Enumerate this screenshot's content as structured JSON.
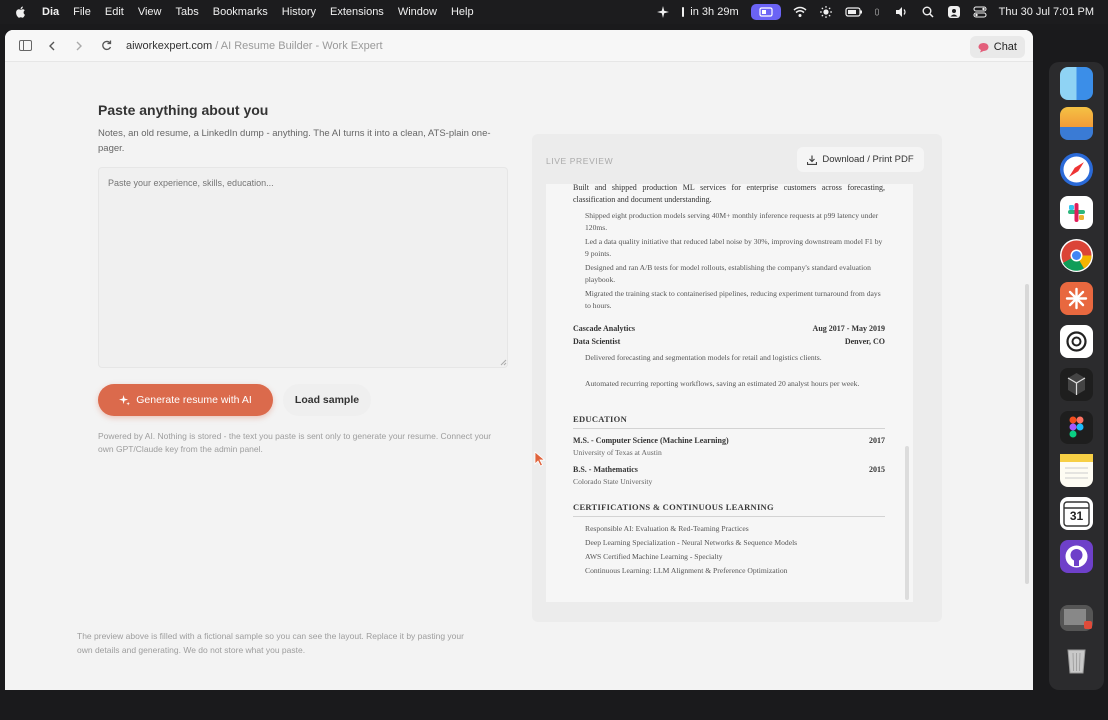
{
  "menubar": {
    "app_name": "Dia",
    "menus": [
      "File",
      "Edit",
      "View",
      "Tabs",
      "Bookmarks",
      "History",
      "Extensions",
      "Window",
      "Help"
    ],
    "timer": "in 3h 29m",
    "datetime": "Thu 30 Jul  7:01 PM"
  },
  "browser": {
    "url_domain": "aiworkexpert.com",
    "url_rest": " / AI Resume Builder - Work Expert",
    "chat_label": "Chat"
  },
  "left": {
    "title": "Paste anything about you",
    "description": "Notes, an old resume, a LinkedIn dump - anything. The AI turns it into a clean, ATS-plain one-pager.",
    "textarea_placeholder": "Paste your experience, skills, education...",
    "generate_label": "Generate resume with AI",
    "sample_label": "Load sample",
    "powered": "Powered by AI. Nothing is stored - the text you paste is sent only to generate your resume. Connect your own GPT/Claude key from the admin panel.",
    "footnote": "The preview above is filled with a fictional sample so you can see the layout. Replace it by pasting your own details and generating. We do not store what you paste."
  },
  "preview": {
    "label": "LIVE PREVIEW",
    "download_label": "Download / Print PDF",
    "intro": "Built and shipped production ML services for enterprise customers across forecasting, classification and document understanding.",
    "job1_bullets": [
      "Shipped eight production models serving 40M+ monthly inference requests at p99 latency under 120ms.",
      "Led a data quality initiative that reduced label noise by 30%, improving downstream model F1 by 9 points.",
      "Designed and ran A/B tests for model rollouts, establishing the company's standard evaluation playbook.",
      "Migrated the training stack to containerised pipelines, reducing experiment turnaround from days to hours."
    ],
    "job2": {
      "company": "Cascade Analytics",
      "dates": "Aug 2017 - May 2019",
      "role": "Data Scientist",
      "location": "Denver, CO",
      "bullets": [
        "Delivered forecasting and segmentation models for retail and logistics clients.",
        "Automated recurring reporting workflows, saving an estimated 20 analyst hours per week."
      ]
    },
    "education_heading": "EDUCATION",
    "education": [
      {
        "degree": "M.S. - Computer Science (Machine Learning)",
        "year": "2017",
        "school": "University of Texas at Austin"
      },
      {
        "degree": "B.S. - Mathematics",
        "year": "2015",
        "school": "Colorado State University"
      }
    ],
    "cert_heading": "CERTIFICATIONS & CONTINUOUS LEARNING",
    "certs": [
      "Responsible AI: Evaluation & Red-Teaming Practices",
      "Deep Learning Specialization - Neural Networks & Sequence Models",
      "AWS Certified Machine Learning - Specialty",
      "Continuous Learning: LLM Alignment & Preference Optimization"
    ]
  },
  "dock": {
    "icons": [
      "finder-icon",
      "weather-icon",
      "safari-icon",
      "slack-icon",
      "chrome-icon",
      "claude-icon",
      "chatgpt-icon",
      "cursor-icon",
      "figma-icon",
      "notes-icon",
      "calendar-icon",
      "github-icon",
      "preview-icon",
      "trash-icon"
    ],
    "calendar_day": "31"
  }
}
